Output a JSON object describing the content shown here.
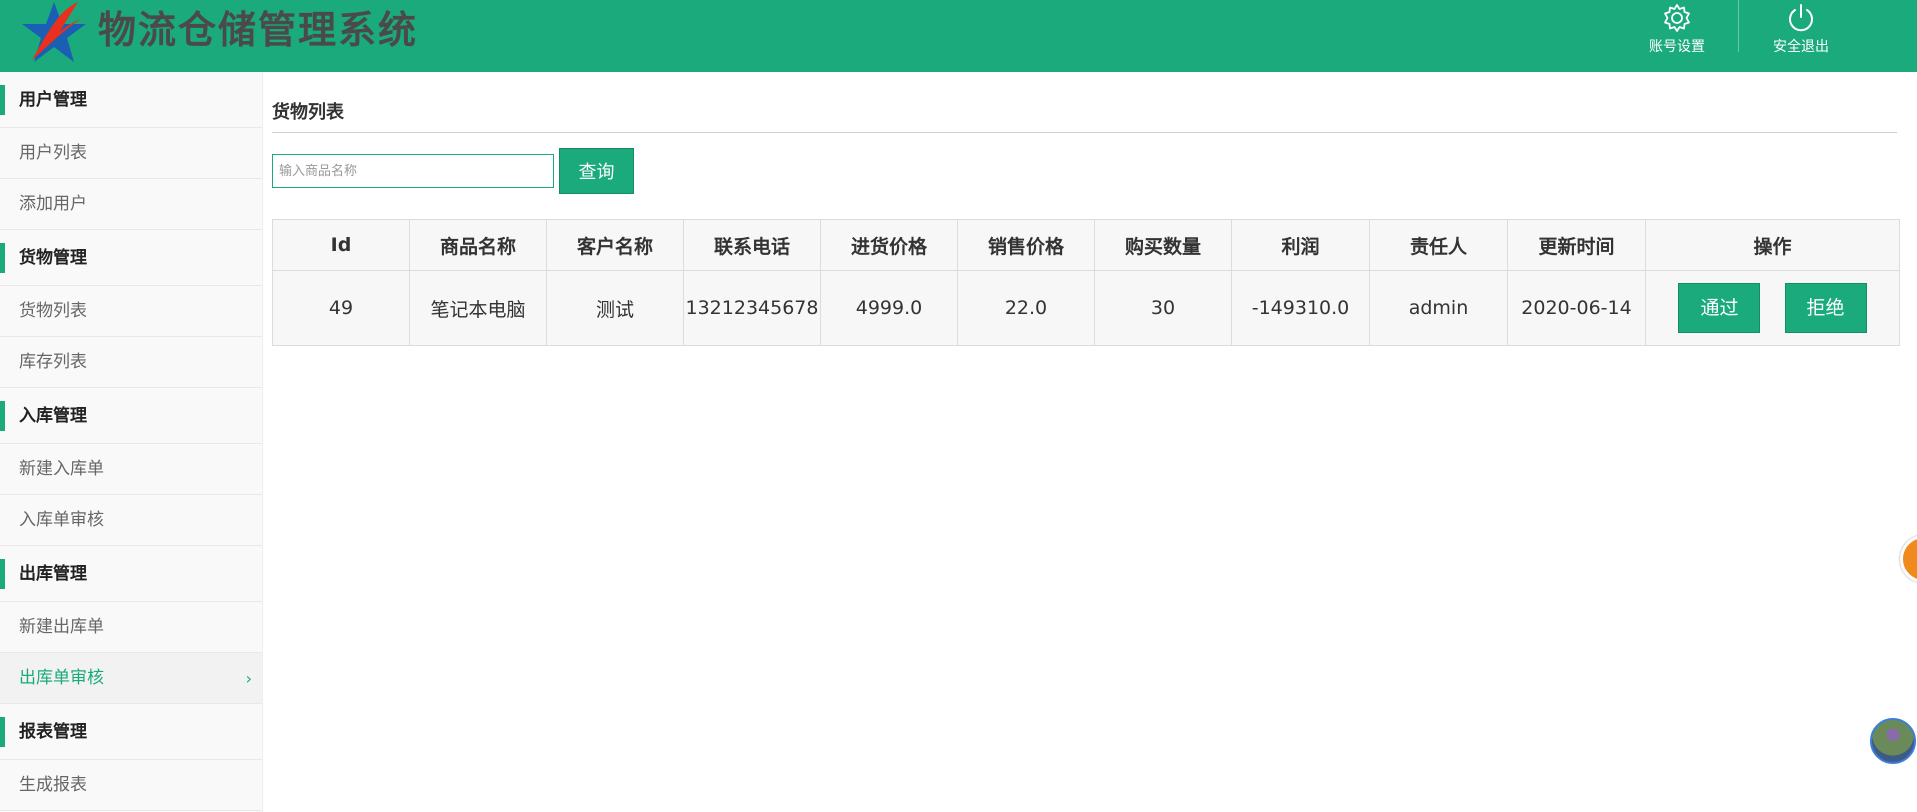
{
  "header": {
    "app_title": "物流仓储管理系统",
    "account_settings": "账号设置",
    "logout": "安全退出",
    "colors": {
      "brand": "#1aaa7c",
      "logo_star": "#1a5fb4",
      "logo_swoosh": "#e8301c"
    }
  },
  "sidebar": {
    "items": [
      {
        "label": "用户管理",
        "type": "group"
      },
      {
        "label": "用户列表",
        "type": "link"
      },
      {
        "label": "添加用户",
        "type": "link"
      },
      {
        "label": "货物管理",
        "type": "group"
      },
      {
        "label": "货物列表",
        "type": "link"
      },
      {
        "label": "库存列表",
        "type": "link"
      },
      {
        "label": "入库管理",
        "type": "group"
      },
      {
        "label": "新建入库单",
        "type": "link"
      },
      {
        "label": "入库单审核",
        "type": "link"
      },
      {
        "label": "出库管理",
        "type": "group"
      },
      {
        "label": "新建出库单",
        "type": "link"
      },
      {
        "label": "出库单审核",
        "type": "link",
        "active": true
      },
      {
        "label": "报表管理",
        "type": "group"
      },
      {
        "label": "生成报表",
        "type": "link"
      }
    ]
  },
  "main": {
    "title": "货物列表",
    "search": {
      "placeholder": "输入商品名称",
      "value": "",
      "button": "查询"
    },
    "table": {
      "columns": [
        "Id",
        "商品名称",
        "客户名称",
        "联系电话",
        "进货价格",
        "销售价格",
        "购买数量",
        "利润",
        "责任人",
        "更新时间",
        "操作"
      ],
      "rows": [
        {
          "id": "49",
          "product": "笔记本电脑",
          "customer": "测试",
          "phone": "13212345678",
          "purchase_price": "4999.0",
          "sale_price": "22.0",
          "quantity": "30",
          "profit": "-149310.0",
          "owner": "admin",
          "updated": "2020-06-14",
          "actions": [
            "通过",
            "拒绝"
          ]
        }
      ]
    }
  }
}
